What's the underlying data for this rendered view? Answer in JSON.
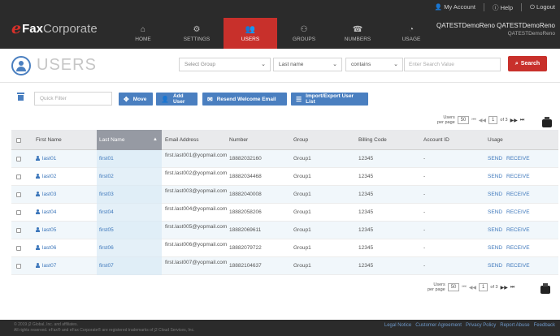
{
  "header": {
    "logo": {
      "e": "e",
      "fax": "Fax",
      "corp": "Corporate"
    },
    "nav": [
      {
        "label": "HOME",
        "icon": "home-icon",
        "glyph": "⌂"
      },
      {
        "label": "SETTINGS",
        "icon": "gear-icon",
        "glyph": "⚙"
      },
      {
        "label": "USERS",
        "icon": "users-icon",
        "glyph": "👥"
      },
      {
        "label": "GROUPS",
        "icon": "groups-icon",
        "glyph": "⚇"
      },
      {
        "label": "NUMBERS",
        "icon": "phone-icon",
        "glyph": "☎"
      },
      {
        "label": "USAGE",
        "icon": "chart-icon",
        "glyph": "◔"
      }
    ],
    "active_nav": "USERS",
    "util": {
      "account": "My Account",
      "help": "Help",
      "logout": "Logout"
    },
    "account_name": "QATESTDemoReno QATESTDemoReno",
    "account_sub": "QATESTDemoReno"
  },
  "title": "USERS",
  "filters": {
    "group": "Select Group",
    "field": "Last name",
    "op": "contains",
    "search_placeholder": "Enter Search Value",
    "search_label": "Search"
  },
  "toolbar": {
    "quick_filter": "Quick Filter",
    "move": "Move",
    "add_user": "Add User",
    "resend": "Resend Welcome Email",
    "import_export": "Import/Export User List"
  },
  "pager": {
    "label_line1": "Users",
    "label_line2": "per page",
    "per_page": "50",
    "page": "1",
    "of": "of 3"
  },
  "pager_bottom": {
    "label_line1": "Users",
    "label_line2": "per page",
    "per_page": "50",
    "page": "1",
    "of": "of 3"
  },
  "table": {
    "headers": [
      "First Name",
      "Last Name",
      "Email Address",
      "Number",
      "Group",
      "Billing Code",
      "Account ID",
      "Usage"
    ],
    "sorted_arrow": "▲",
    "rows": [
      {
        "first": "last01",
        "last": "first01",
        "email": "first.last001@yopmail.com",
        "number": "18882032160",
        "group": "Group1",
        "billing": "12345",
        "account": "-",
        "send": "SEND",
        "receive": "RECEIVE"
      },
      {
        "first": "last02",
        "last": "first02",
        "email": "first.last002@yopmail.com",
        "number": "18882034468",
        "group": "Group1",
        "billing": "12345",
        "account": "-",
        "send": "SEND",
        "receive": "RECEIVE"
      },
      {
        "first": "last03",
        "last": "first03",
        "email": "first.last003@yopmail.com",
        "number": "18882040008",
        "group": "Group1",
        "billing": "12345",
        "account": "-",
        "send": "SEND",
        "receive": "RECEIVE"
      },
      {
        "first": "last04",
        "last": "first04",
        "email": "first.last004@yopmail.com",
        "number": "18882058206",
        "group": "Group1",
        "billing": "12345",
        "account": "-",
        "send": "SEND",
        "receive": "RECEIVE"
      },
      {
        "first": "last05",
        "last": "first05",
        "email": "first.last005@yopmail.com",
        "number": "18882069611",
        "group": "Group1",
        "billing": "12345",
        "account": "-",
        "send": "SEND",
        "receive": "RECEIVE"
      },
      {
        "first": "last06",
        "last": "first06",
        "email": "first.last006@yopmail.com",
        "number": "18882079722",
        "group": "Group1",
        "billing": "12345",
        "account": "-",
        "send": "SEND",
        "receive": "RECEIVE"
      },
      {
        "first": "last07",
        "last": "first07",
        "email": "first.last007@yopmail.com",
        "number": "18882104637",
        "group": "Group1",
        "billing": "12345",
        "account": "-",
        "send": "SEND",
        "receive": "RECEIVE"
      }
    ]
  },
  "footer": {
    "copyright1": "© 2019 j2 Global, Inc. and affiliates.",
    "copyright2": "All rights reserved. eFax® and eFax Corporate® are registered trademarks of j2 Cloud Services, Inc.",
    "links": [
      "Legal Notice",
      "Customer Agreement",
      "Privacy Policy",
      "Report Abuse",
      "Feedback"
    ]
  },
  "colors": {
    "brand_red": "#c8302b",
    "accent_blue": "#4a7fc0",
    "header_bg": "#2b2b2b"
  }
}
